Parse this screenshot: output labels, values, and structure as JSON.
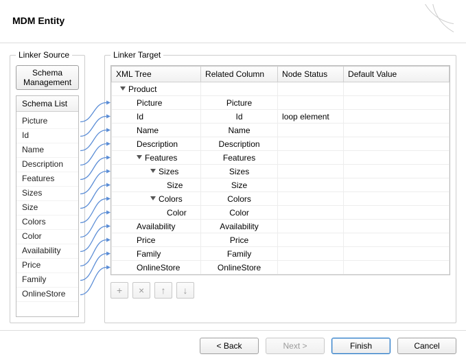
{
  "header": {
    "title": "MDM Entity"
  },
  "source": {
    "legend": "Linker Source",
    "schema_mgmt_label": "Schema Management",
    "list_header": "Schema List",
    "items": [
      "Picture",
      "Id",
      "Name",
      "Description",
      "Features",
      "Sizes",
      "Size",
      "Colors",
      "Color",
      "Availability",
      "Price",
      "Family",
      "OnlineStore"
    ]
  },
  "target": {
    "legend": "Linker Target",
    "columns": {
      "c0": "XML Tree",
      "c1": "Related Column",
      "c2": "Node Status",
      "c3": "Default Value"
    },
    "rows": [
      {
        "indent": 1,
        "toggle": true,
        "name": "Product",
        "rel": "",
        "status": "",
        "def": ""
      },
      {
        "indent": 2,
        "toggle": false,
        "name": "Picture",
        "rel": "Picture",
        "status": "",
        "def": ""
      },
      {
        "indent": 2,
        "toggle": false,
        "name": "Id",
        "rel": "Id",
        "status": "loop element",
        "def": ""
      },
      {
        "indent": 2,
        "toggle": false,
        "name": "Name",
        "rel": "Name",
        "status": "",
        "def": ""
      },
      {
        "indent": 2,
        "toggle": false,
        "name": "Description",
        "rel": "Description",
        "status": "",
        "def": ""
      },
      {
        "indent": 2,
        "toggle": true,
        "name": "Features",
        "rel": "Features",
        "status": "",
        "def": ""
      },
      {
        "indent": 3,
        "toggle": true,
        "name": "Sizes",
        "rel": "Sizes",
        "status": "",
        "def": ""
      },
      {
        "indent": 4,
        "toggle": false,
        "name": "Size",
        "rel": "Size",
        "status": "",
        "def": ""
      },
      {
        "indent": 3,
        "toggle": true,
        "name": "Colors",
        "rel": "Colors",
        "status": "",
        "def": ""
      },
      {
        "indent": 4,
        "toggle": false,
        "name": "Color",
        "rel": "Color",
        "status": "",
        "def": ""
      },
      {
        "indent": 2,
        "toggle": false,
        "name": "Availability",
        "rel": "Availability",
        "status": "",
        "def": ""
      },
      {
        "indent": 2,
        "toggle": false,
        "name": "Price",
        "rel": "Price",
        "status": "",
        "def": ""
      },
      {
        "indent": 2,
        "toggle": false,
        "name": "Family",
        "rel": "Family",
        "status": "",
        "def": ""
      },
      {
        "indent": 2,
        "toggle": false,
        "name": "OnlineStore",
        "rel": "OnlineStore",
        "status": "",
        "def": ""
      }
    ],
    "toolbar": {
      "add": "+",
      "delete": "×",
      "up": "↑",
      "down": "↓"
    }
  },
  "links": [
    {
      "from": 0,
      "to": 1
    },
    {
      "from": 1,
      "to": 2
    },
    {
      "from": 2,
      "to": 3
    },
    {
      "from": 3,
      "to": 4
    },
    {
      "from": 4,
      "to": 5
    },
    {
      "from": 5,
      "to": 6
    },
    {
      "from": 6,
      "to": 7
    },
    {
      "from": 7,
      "to": 8
    },
    {
      "from": 8,
      "to": 9
    },
    {
      "from": 9,
      "to": 10
    },
    {
      "from": 10,
      "to": 11
    },
    {
      "from": 11,
      "to": 12
    },
    {
      "from": 12,
      "to": 13
    }
  ],
  "footer": {
    "back": "< Back",
    "next": "Next >",
    "finish": "Finish",
    "cancel": "Cancel"
  }
}
